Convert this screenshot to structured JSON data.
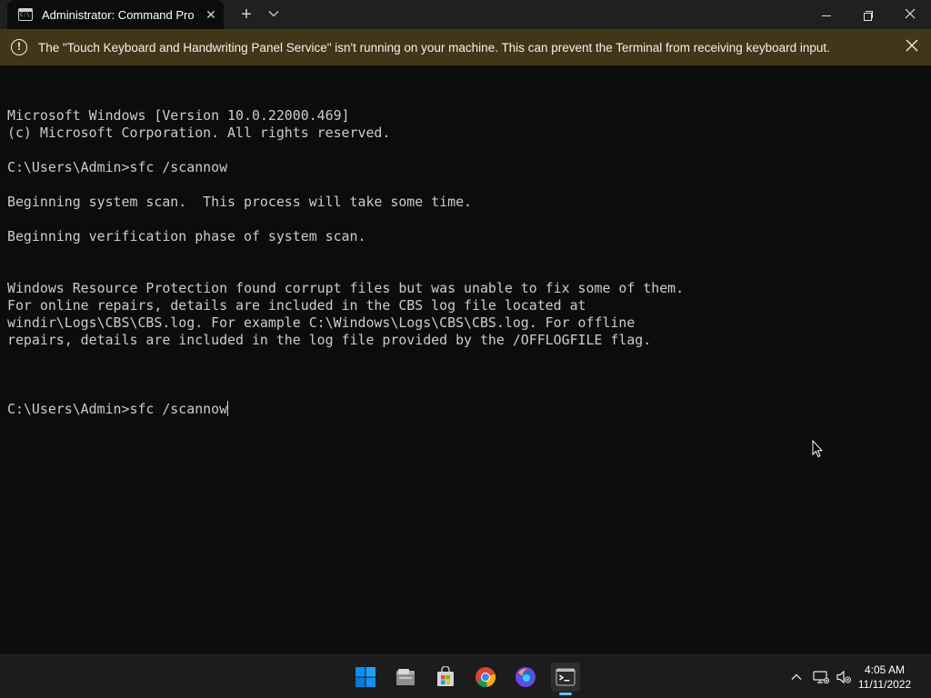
{
  "window": {
    "tab_title": "Administrator: Command Prompt",
    "tab_icon_text": "C:\\"
  },
  "infobar": {
    "message": "The \"Touch Keyboard and Handwriting Panel Service\" isn't running on your machine. This can prevent the Terminal from receiving keyboard input."
  },
  "terminal": {
    "lines": [
      "Microsoft Windows [Version 10.0.22000.469]",
      "(c) Microsoft Corporation. All rights reserved.",
      "",
      "C:\\Users\\Admin>sfc /scannow",
      "",
      "Beginning system scan.  This process will take some time.",
      "",
      "Beginning verification phase of system scan.",
      "",
      "",
      "Windows Resource Protection found corrupt files but was unable to fix some of them.",
      "For online repairs, details are included in the CBS log file located at",
      "windir\\Logs\\CBS\\CBS.log. For example C:\\Windows\\Logs\\CBS\\CBS.log. For offline",
      "repairs, details are included in the log file provided by the /OFFLOGFILE flag.",
      ""
    ],
    "current_prompt": "C:\\Users\\Admin>",
    "current_input": "sfc /scannow"
  },
  "taskbar": {
    "apps": [
      {
        "name": "start-icon",
        "label": "Start"
      },
      {
        "name": "file-explorer-icon",
        "label": "File Explorer"
      },
      {
        "name": "microsoft-store-icon",
        "label": "Microsoft Store"
      },
      {
        "name": "chrome-icon",
        "label": "Google Chrome"
      },
      {
        "name": "firefox-icon",
        "label": "Firefox"
      },
      {
        "name": "terminal-icon",
        "label": "Terminal"
      }
    ],
    "active_app": "terminal-icon",
    "accent_color": "#5cc3f4"
  },
  "clock": {
    "time": "4:05 AM",
    "date": "11/11/2022"
  },
  "colors": {
    "terminal_bg": "#0c0c0c",
    "terminal_fg": "#cccccc",
    "infobar_bg": "#433519",
    "titlebar_bg": "#202020"
  }
}
